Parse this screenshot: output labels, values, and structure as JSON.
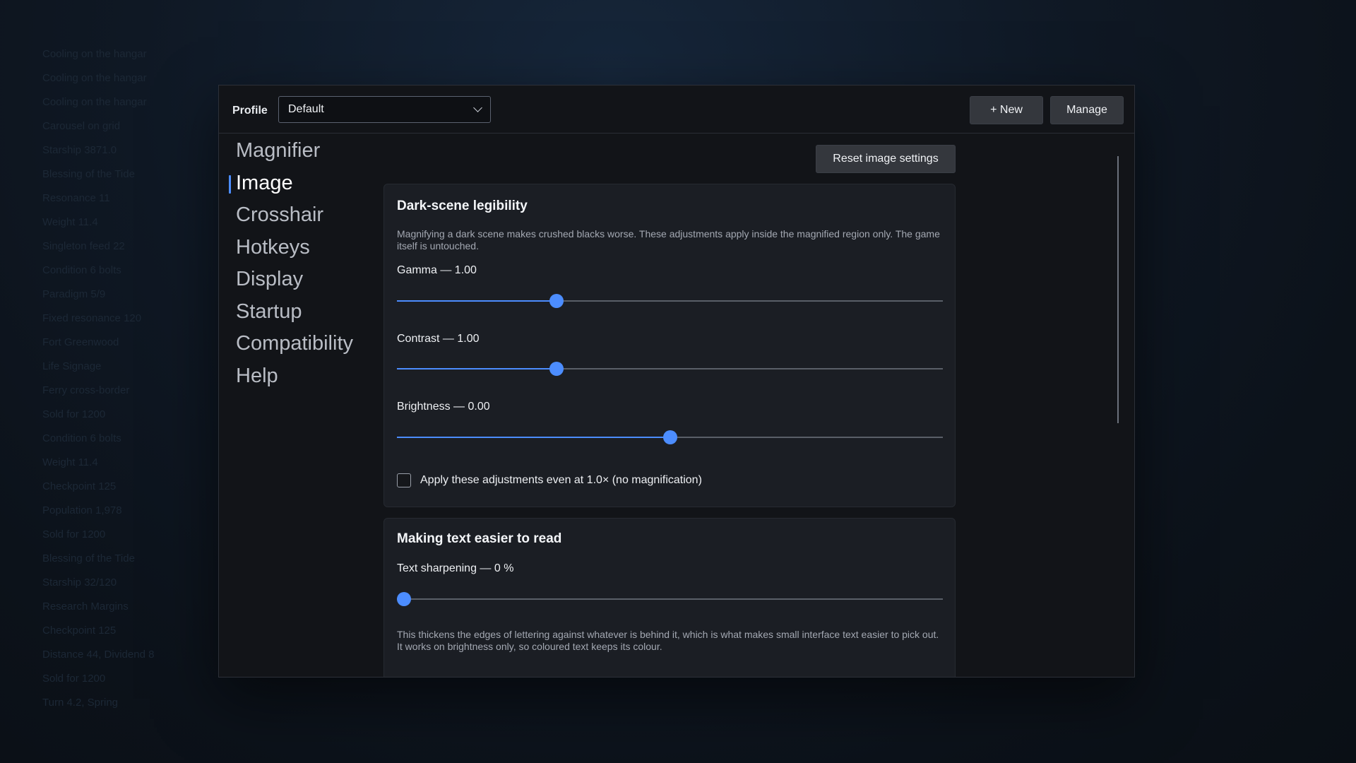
{
  "background_list": [
    "Cooling on the hangar",
    "Cooling on the hangar",
    "Cooling on the hangar",
    "Carousel on grid",
    "Starship 3871.0",
    "Blessing of the Tide",
    "Resonance 11",
    "Weight 11.4",
    "Singleton feed 22",
    "Condition 6 bolts",
    "Paradigm 5/9",
    "Fixed resonance 120",
    "Fort Greenwood",
    "Life Signage",
    "Ferry cross-border",
    "Sold for 1200",
    "Condition 6 bolts",
    "Weight 11.4",
    "Checkpoint 125",
    "Population 1,978",
    "Sold for 1200",
    "Blessing of the Tide",
    "Starship 32/120",
    "Research Margins",
    "Checkpoint 125",
    "Distance 44, Dividend 8",
    "Sold for 1200",
    "Turn 4.2, Spring"
  ],
  "header": {
    "profile_label": "Profile",
    "profile_value": "Default",
    "new_button": "+ New",
    "manage_button": "Manage"
  },
  "nav": {
    "items": [
      "Magnifier",
      "Image",
      "Crosshair",
      "Hotkeys",
      "Display",
      "Startup",
      "Compatibility",
      "Help"
    ],
    "active": "Image"
  },
  "reset_button": "Reset image settings",
  "dark_scene": {
    "title": "Dark-scene legibility",
    "description": "Magnifying a dark scene makes crushed blacks worse. These adjustments apply inside the magnified region only. The game itself is untouched.",
    "gamma": {
      "label": "Gamma — 1.00",
      "fraction": 0.293
    },
    "contrast": {
      "label": "Contrast — 1.00",
      "fraction": 0.293
    },
    "brightness": {
      "label": "Brightness — 0.00",
      "fraction": 0.5
    },
    "checkbox_label": "Apply these adjustments even at 1.0× (no magnification)",
    "checkbox_checked": false
  },
  "text_read": {
    "title": "Making text easier to read",
    "sharpening": {
      "label": "Text sharpening — 0 %",
      "fraction": 0.0
    },
    "description": "This thickens the edges of lettering against whatever is behind it, which is what makes small interface text easier to pick out. It works on brightness only, so coloured text keeps its colour."
  },
  "colors": {
    "accent": "#4c8dff",
    "window_bg": "#121418",
    "card_bg": "#1b1e24"
  }
}
